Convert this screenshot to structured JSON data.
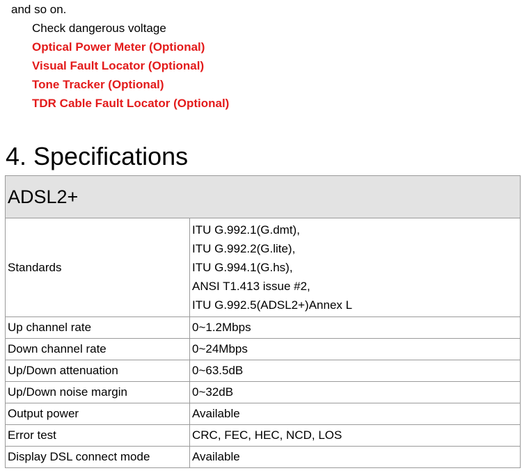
{
  "intro": {
    "continued_text": "and so on.",
    "features": [
      {
        "label": "Check dangerous voltage",
        "optional": false
      },
      {
        "label": "Optical Power Meter (Optional)",
        "optional": true
      },
      {
        "label": "Visual Fault Locator (Optional)",
        "optional": true
      },
      {
        "label": "Tone Tracker (Optional)",
        "optional": true
      },
      {
        "label": "TDR Cable Fault Locator (Optional)",
        "optional": true
      }
    ],
    "optional_color": "#e31b1b"
  },
  "section": {
    "title": "4. Specifications"
  },
  "spec_table": {
    "heading": "ADSL2+",
    "heading_bg": "#e3e3e3",
    "rows": [
      {
        "name": "Standards",
        "values": [
          "ITU G.992.1(G.dmt),",
          "ITU G.992.2(G.lite),",
          "ITU G.994.1(G.hs),",
          "ANSI T1.413 issue #2,",
          "ITU G.992.5(ADSL2+)Annex L"
        ]
      },
      {
        "name": "Up channel rate",
        "values": [
          "0~1.2Mbps"
        ]
      },
      {
        "name": "Down channel rate",
        "values": [
          "0~24Mbps"
        ]
      },
      {
        "name": "Up/Down attenuation",
        "values": [
          "0~63.5dB"
        ]
      },
      {
        "name": "Up/Down noise margin",
        "values": [
          "0~32dB"
        ]
      },
      {
        "name": "Output power",
        "values": [
          "Available"
        ]
      },
      {
        "name": "Error test",
        "values": [
          "CRC, FEC, HEC, NCD, LOS"
        ]
      },
      {
        "name": "Display DSL connect mode",
        "values": [
          "Available"
        ]
      }
    ]
  }
}
